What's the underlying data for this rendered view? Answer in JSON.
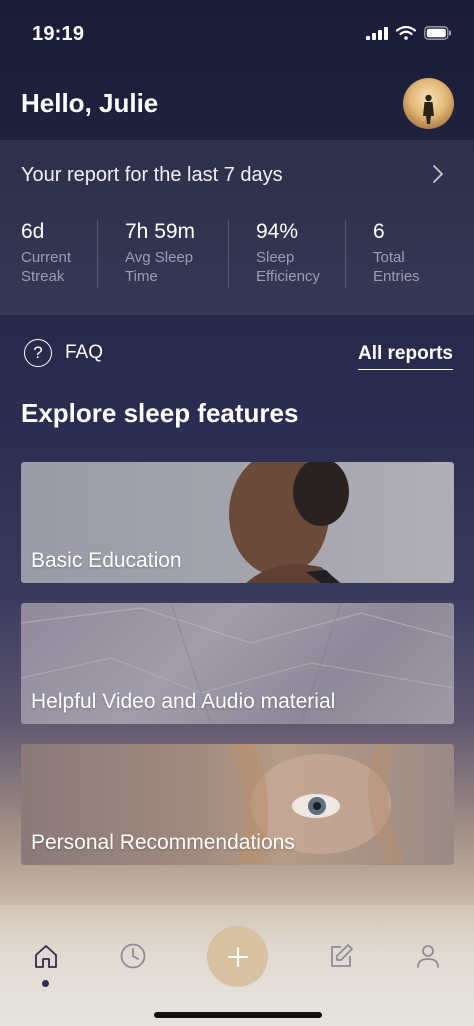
{
  "status_bar": {
    "time": "19:19"
  },
  "header": {
    "greeting": "Hello, Julie"
  },
  "report": {
    "title": "Your report for the last 7 days",
    "stats": [
      {
        "value": "6d",
        "label": "Current Streak"
      },
      {
        "value": "7h 59m",
        "label": "Avg Sleep Time"
      },
      {
        "value": "94%",
        "label": "Sleep Efficiency"
      },
      {
        "value": "6",
        "label": "Total Entries"
      }
    ]
  },
  "links": {
    "faq": "FAQ",
    "all_reports": "All reports"
  },
  "explore": {
    "title": "Explore sleep features",
    "cards": [
      {
        "label": "Basic Education"
      },
      {
        "label": "Helpful Video and Audio material"
      },
      {
        "label": "Personal Recommendations"
      }
    ]
  },
  "tab_bar": {
    "active_tab": "home",
    "tabs": [
      "home-icon",
      "clock-icon",
      "add-icon",
      "edit-icon",
      "profile-icon"
    ]
  },
  "colors": {
    "accent": "#d7c2a2",
    "background_top": "#1b1c36",
    "label_muted": "#9b9cb5"
  }
}
